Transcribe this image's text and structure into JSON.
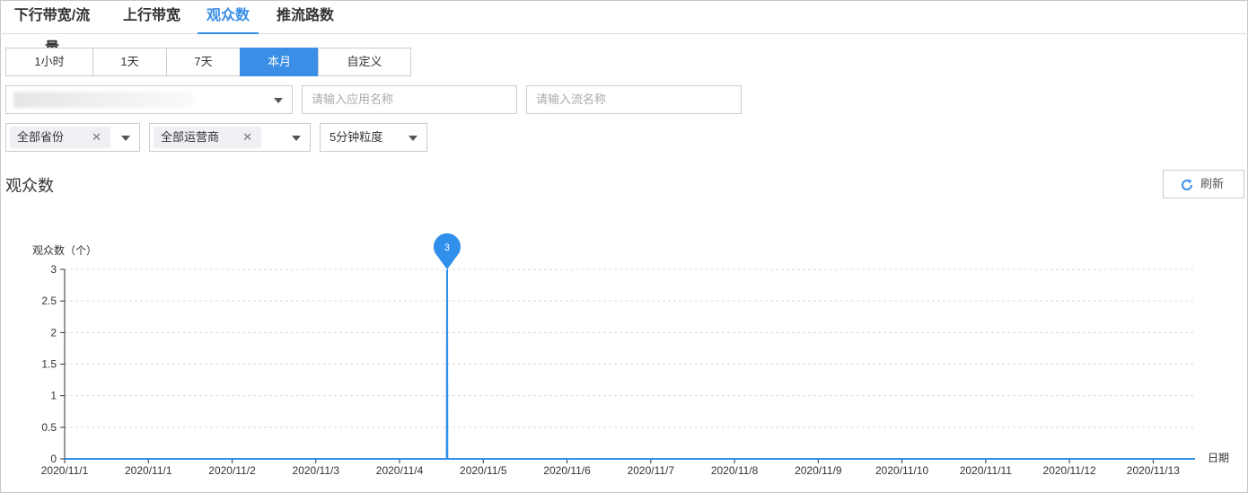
{
  "tabs": [
    {
      "label": "下行带宽/流量",
      "active": false
    },
    {
      "label": "上行带宽",
      "active": false
    },
    {
      "label": "观众数",
      "active": true
    },
    {
      "label": "推流路数",
      "active": false
    }
  ],
  "time_range": {
    "options": [
      "1小时",
      "1天",
      "7天",
      "本月",
      "自定义"
    ],
    "selected": "本月"
  },
  "filters": {
    "domain_value": "",
    "app_placeholder": "请输入应用名称",
    "stream_placeholder": "请输入流名称",
    "province": "全部省份",
    "isp": "全部运营商",
    "granularity": "5分钟粒度",
    "clear_glyph": "✕"
  },
  "section": {
    "title": "观众数",
    "refresh_label": "刷新",
    "refresh_icon": "refresh-icon"
  },
  "colors": {
    "accent": "#3a8ee6",
    "series": "#2f8fea",
    "grid": "#d9d9d9"
  },
  "chart_data": {
    "type": "line",
    "ylabel": "观众数（个）",
    "xlabel": "日期",
    "ylim": [
      0,
      3
    ],
    "yticks": [
      "3",
      "2.5",
      "2",
      "1.5",
      "1",
      "0.5",
      "0"
    ],
    "xticks": [
      "2020/11/1",
      "2020/11/1",
      "2020/11/2",
      "2020/11/3",
      "2020/11/4",
      "2020/11/5",
      "2020/11/6",
      "2020/11/7",
      "2020/11/8",
      "2020/11/9",
      "2020/11/10",
      "2020/11/11",
      "2020/11/12",
      "2020/11/13"
    ],
    "grid": true,
    "x_start": "2020-11-01T00:00",
    "x_end": "2020-11-14T04:00",
    "series": [
      {
        "points": [
          {
            "x": "2020-11-01T00:00",
            "y": 0
          },
          {
            "x": "2020-11-05T10:50",
            "y": 0
          },
          {
            "x": "2020-11-05T10:55",
            "y": 3
          },
          {
            "x": "2020-11-05T11:00",
            "y": 0
          },
          {
            "x": "2020-11-14T04:00",
            "y": 0
          }
        ]
      }
    ],
    "max_marker": {
      "x": "2020-11-05T10:55",
      "y": 3,
      "label": "3"
    }
  }
}
